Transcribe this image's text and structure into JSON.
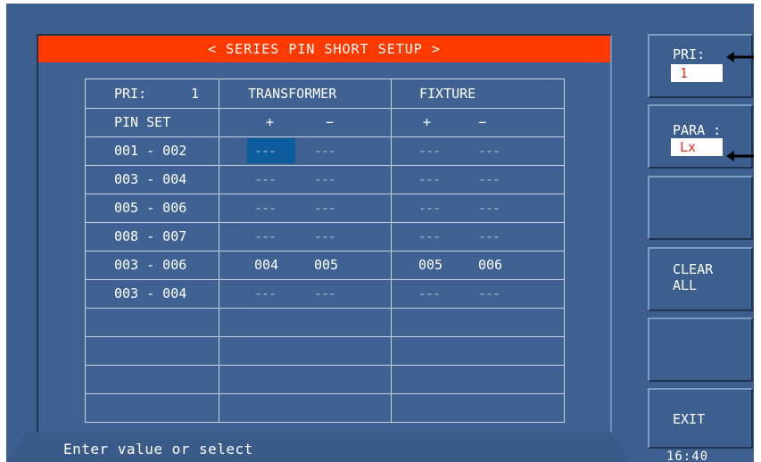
{
  "title": "< SERIES PIN SHORT SETUP >",
  "header": {
    "pri_label": "PRI:",
    "pri_value": "1",
    "transformer": "TRANSFORMER",
    "fixture": "FIXTURE",
    "pin_set": "PIN SET",
    "plus": "+",
    "minus": "−"
  },
  "rows": [
    {
      "pins": "001 - 002",
      "t_plus": "---",
      "t_minus": "---",
      "f_plus": "---",
      "f_minus": "---"
    },
    {
      "pins": "003 - 004",
      "t_plus": "---",
      "t_minus": "---",
      "f_plus": "---",
      "f_minus": "---"
    },
    {
      "pins": "005 - 006",
      "t_plus": "---",
      "t_minus": "---",
      "f_plus": "---",
      "f_minus": "---"
    },
    {
      "pins": "008 - 007",
      "t_plus": "---",
      "t_minus": "---",
      "f_plus": "---",
      "f_minus": "---"
    },
    {
      "pins": "003 - 006",
      "t_plus": "004",
      "t_minus": "005",
      "f_plus": "005",
      "f_minus": "006"
    },
    {
      "pins": "003 - 004",
      "t_plus": "---",
      "t_minus": "---",
      "f_plus": "---",
      "f_minus": "---"
    }
  ],
  "status": "Enter value or select",
  "softkeys": {
    "pri_label": "PRI:",
    "pri_value": "1",
    "para_label": "PARA :",
    "para_value": "Lx",
    "clear_line1": "CLEAR",
    "clear_line2": "ALL",
    "exit": "EXIT"
  },
  "clock": "16:40",
  "colors": {
    "title_bar": "#ff3a00",
    "screen_bg": "#3d5f8f",
    "selected_cell": "#0d5d9e",
    "value_text": "#e53018"
  }
}
